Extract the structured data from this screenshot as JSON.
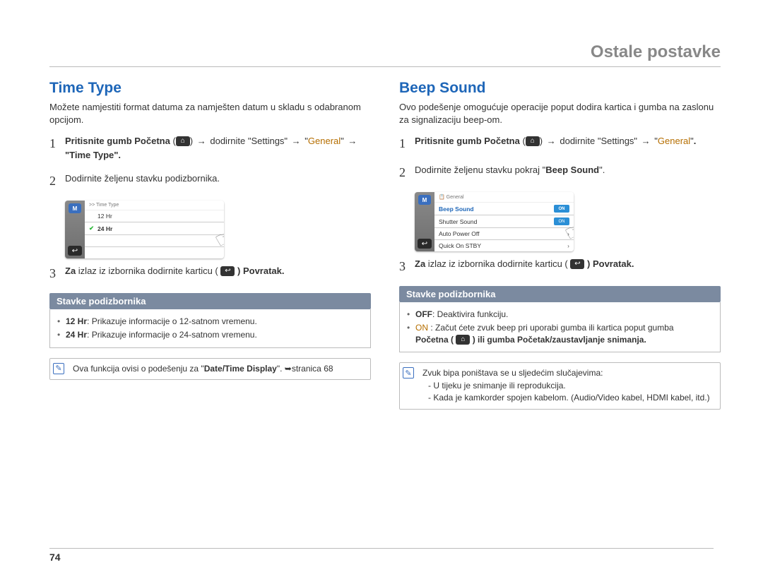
{
  "header": {
    "title": "Ostale postavke"
  },
  "pageNumber": "74",
  "left": {
    "title": "Time Type",
    "intro": "Možete namjestiti format datuma za namješten datum u skladu s odabranom opcijom.",
    "step1": {
      "prefix": "Pritisnite",
      "btnLabel": "gumb Početna",
      "navSettings": "dodirnite \"Settings\"",
      "general": "General",
      "tail": "\"Time Type\"."
    },
    "step2": "Dodirnite željenu stavku podizbornika.",
    "step3": {
      "prefix": "Za",
      "mid": "izlaz iz izbornika dodirnite karticu (",
      "tail": ") Povratak."
    },
    "screenshot": {
      "crumb": ">> Time Type",
      "row1": "12 Hr",
      "row2": "24 Hr"
    },
    "submenuHeader": "Stavke podizbornika",
    "submenu": {
      "row1": {
        "bold": "12 Hr",
        "text": ": Prikazuje informacije o 12-satnom vremenu."
      },
      "row2": {
        "bold": "24 Hr",
        "text": ": Prikazuje informacije o 24-satnom vremenu."
      }
    },
    "note": {
      "text": "Ova funkcija ovisi o podešenju za \"",
      "bold": "Date/Time Display",
      "tail": "\". ➥stranica 68"
    }
  },
  "right": {
    "title": "Beep Sound",
    "intro": "Ovo podešenje omogućuje operacije poput dodira kartica i gumba na zaslonu za signalizaciju beep-om.",
    "step1": {
      "prefix": "Pritisnite",
      "btnLabel": "gumb Početna",
      "navSettings": "dodirnite \"Settings\"",
      "general": "General",
      "tail": "."
    },
    "step2": {
      "text": "Dodirnite željenu stavku pokraj \"",
      "bold": "Beep Sound",
      "tail": "\"."
    },
    "step3": {
      "prefix": "Za",
      "mid": "izlaz iz izbornika dodirnite karticu (",
      "tail": ") Povratak."
    },
    "screenshot": {
      "crumb": "General",
      "row1": "Beep Sound",
      "row1toggle": "ON",
      "row2": "Shutter Sound",
      "row2toggle": "ON",
      "row3": "Auto Power Off",
      "row4": "Quick On STBY"
    },
    "submenuHeader": "Stavke podizbornika",
    "submenu": {
      "row1": {
        "bold": "OFF",
        "text": ": Deaktivira funkciju."
      },
      "row2": {
        "lead": "ON",
        "text": ": Začut ćete zvuk beep pri uporabi gumba ili kartica poput gumba",
        "bold2a": "Početna (",
        "bold2b": ") ili gumba Početak/zaustavljanje snimanja."
      }
    },
    "note": {
      "line1": "Zvuk bipa poništava se u sljedećim slučajevima:",
      "line2": "- U tijeku je snimanje ili reprodukcija.",
      "line3": "- Kada je kamkorder spojen kabelom. (Audio/Video kabel, HDMI kabel, itd.)"
    }
  }
}
